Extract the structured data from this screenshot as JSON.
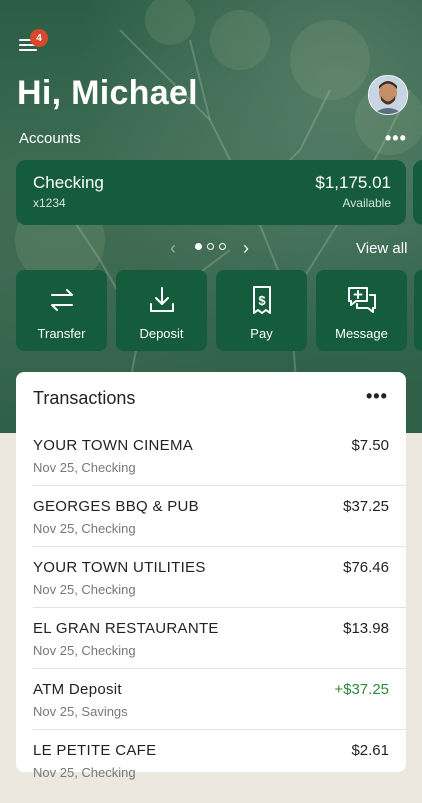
{
  "header": {
    "notification_count": "4",
    "greeting": "Hi, Michael"
  },
  "accounts": {
    "label": "Accounts",
    "more": "•••",
    "card": {
      "name": "Checking",
      "number": "x1234",
      "balance": "$1,175.01",
      "balance_label": "Available"
    },
    "pager": {
      "prev": "‹",
      "next": "›",
      "pages": 3,
      "active_page": 1
    },
    "view_all": "View all"
  },
  "actions": [
    {
      "label": "Transfer",
      "icon": "transfer-icon"
    },
    {
      "label": "Deposit",
      "icon": "deposit-icon"
    },
    {
      "label": "Pay",
      "icon": "pay-bill-icon"
    },
    {
      "label": "Message",
      "icon": "message-icon"
    }
  ],
  "transactions": {
    "title": "Transactions",
    "more": "•••",
    "items": [
      {
        "description": "YOUR TOWN CINEMA",
        "date_account": "Nov 25, Checking",
        "amount": "$7.50",
        "credit": false
      },
      {
        "description": "GEORGES BBQ & PUB",
        "date_account": "Nov 25, Checking",
        "amount": "$37.25",
        "credit": false
      },
      {
        "description": "YOUR TOWN UTILITIES",
        "date_account": "Nov 25, Checking",
        "amount": "$76.46",
        "credit": false
      },
      {
        "description": "EL GRAN RESTAURANTE",
        "date_account": "Nov 25, Checking",
        "amount": "$13.98",
        "credit": false
      },
      {
        "description": "ATM Deposit",
        "date_account": "Nov 25, Savings",
        "amount": "+$37.25",
        "credit": true
      },
      {
        "description": "LE PETITE CAFE",
        "date_account": "Nov 25, Checking",
        "amount": "$2.61",
        "credit": false
      }
    ]
  },
  "colors": {
    "brand_green": "#155c3c",
    "credit_green": "#2f8a3a",
    "badge_red": "#d9482b"
  }
}
